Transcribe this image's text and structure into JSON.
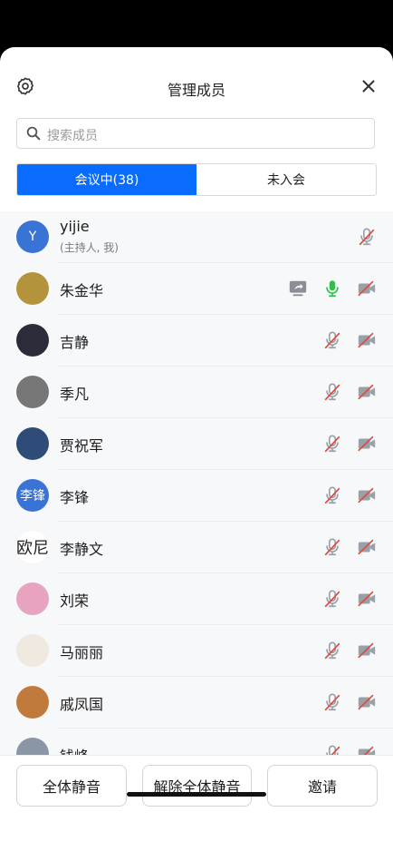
{
  "header": {
    "title": "管理成员",
    "settings_icon": "gear-icon",
    "close_icon": "close-icon"
  },
  "search": {
    "placeholder": "搜索成员"
  },
  "tabs": [
    {
      "label": "会议中(38)",
      "active": true
    },
    {
      "label": "未入会",
      "active": false
    }
  ],
  "members": [
    {
      "name": "yijie",
      "sub": "(主持人, 我)",
      "avatar_text": "Y",
      "avatar_color": "#3a73d6",
      "sharing": false,
      "mic": "muted",
      "camera": "none"
    },
    {
      "name": "朱金华",
      "sub": "",
      "avatar_text": "",
      "avatar_color": "#b4933d",
      "sharing": true,
      "mic": "on",
      "camera": "off"
    },
    {
      "name": "吉静",
      "sub": "",
      "avatar_text": "",
      "avatar_color": "#2b2b3a",
      "sharing": false,
      "mic": "muted",
      "camera": "off"
    },
    {
      "name": "季凡",
      "sub": "",
      "avatar_text": "",
      "avatar_color": "#777777",
      "sharing": false,
      "mic": "muted",
      "camera": "off"
    },
    {
      "name": "贾祝军",
      "sub": "",
      "avatar_text": "",
      "avatar_color": "#2f4b78",
      "sharing": false,
      "mic": "muted",
      "camera": "off"
    },
    {
      "name": "李锋",
      "sub": "",
      "avatar_text": "李锋",
      "avatar_color": "#3a73d6",
      "sharing": false,
      "mic": "muted",
      "camera": "off"
    },
    {
      "name": "李静文",
      "sub": "",
      "avatar_text": "欧尼",
      "avatar_color": "#ffffff",
      "sharing": false,
      "mic": "muted",
      "camera": "off"
    },
    {
      "name": "刘荣",
      "sub": "",
      "avatar_text": "",
      "avatar_color": "#e7a3c0",
      "sharing": false,
      "mic": "muted",
      "camera": "off"
    },
    {
      "name": "马丽丽",
      "sub": "",
      "avatar_text": "",
      "avatar_color": "#efe9e0",
      "sharing": false,
      "mic": "muted",
      "camera": "off"
    },
    {
      "name": "戚凤国",
      "sub": "",
      "avatar_text": "",
      "avatar_color": "#c07a3c",
      "sharing": false,
      "mic": "muted",
      "camera": "off"
    },
    {
      "name": "钱峰",
      "sub": "",
      "avatar_text": "",
      "avatar_color": "#8a95a5",
      "sharing": false,
      "mic": "muted",
      "camera": "off"
    }
  ],
  "footer": {
    "mute_all": "全体静音",
    "unmute_all": "解除全体静音",
    "invite": "邀请"
  },
  "colors": {
    "accent": "#0a6cff",
    "mic_on": "#2ec24a",
    "muted_slash": "#e0493a",
    "icon_gray": "#9aa0a8"
  }
}
